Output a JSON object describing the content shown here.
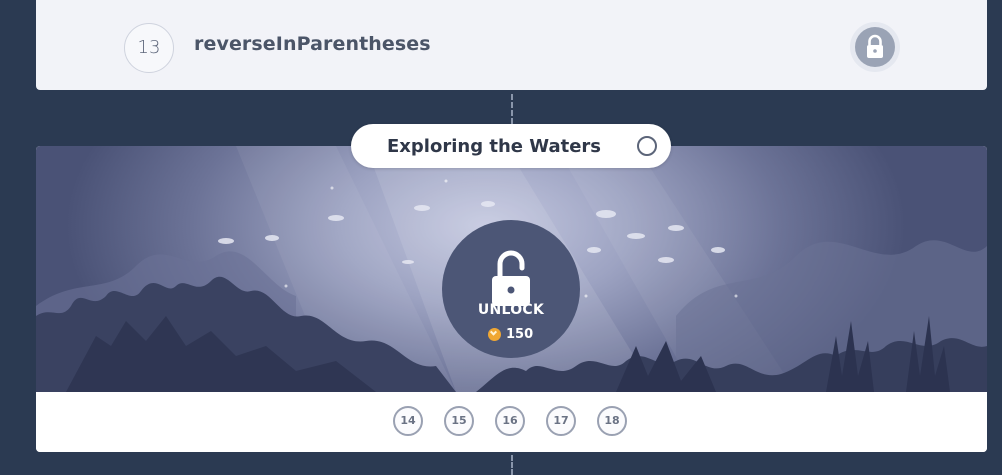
{
  "previous_level": {
    "number": "13",
    "title": "reverseInParentheses",
    "status_icon": "lock-icon"
  },
  "section": {
    "title": "Exploring the Waters",
    "status_icon": "empty-circle-icon",
    "unlock_label": "UNLOCK",
    "unlock_icon": "open-padlock-icon",
    "coin_icon": "coin-icon",
    "price": "150",
    "levels": [
      "14",
      "15",
      "16",
      "17",
      "18"
    ]
  },
  "colors": {
    "background": "#2b3a52",
    "card": "#f2f3f8",
    "unlock_circle": "#4c5676",
    "coin": "#f0a733"
  }
}
